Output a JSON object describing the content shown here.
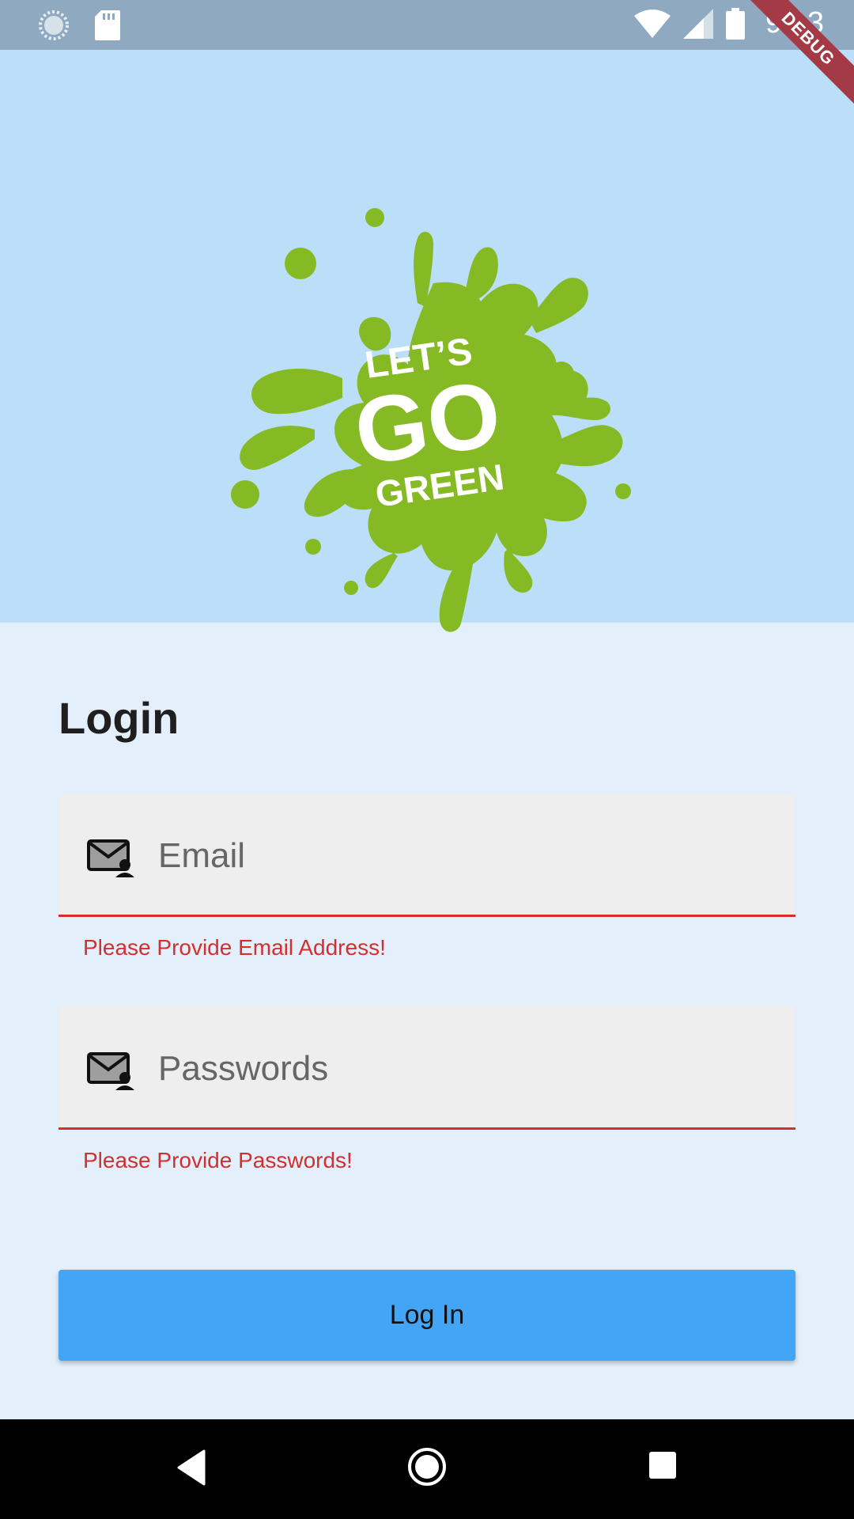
{
  "status_bar": {
    "time": "9:13",
    "left_icons": [
      "sync-icon",
      "sd-card-icon"
    ],
    "right_icons": [
      "wifi-icon",
      "cell-signal-icon",
      "battery-icon"
    ]
  },
  "debug_banner": {
    "label": "DEBUG",
    "color": "#A43A45"
  },
  "hero": {
    "background": "#BBDEF9",
    "logo": {
      "line1": "LET’S",
      "line2": "GO",
      "line3": "GREEN",
      "color": "#86BA25"
    }
  },
  "login": {
    "title": "Login",
    "email": {
      "placeholder": "Email",
      "value": "",
      "error": "Please Provide Email Address!",
      "icon": "contact-mail-icon"
    },
    "password": {
      "placeholder": "Passwords",
      "value": "",
      "error": "Please Provide Passwords!",
      "icon": "contact-mail-icon"
    },
    "submit_label": "Log In"
  },
  "colors": {
    "accent": "#42A5F5",
    "error": "#D32F2F",
    "page_background": "#E3F0FC"
  },
  "nav_bar": {
    "buttons": [
      "back-icon",
      "home-icon",
      "recents-icon"
    ]
  }
}
